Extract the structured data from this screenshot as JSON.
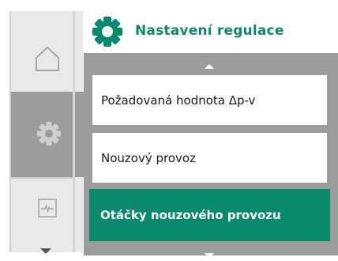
{
  "header": {
    "title": "Nastavení regulace",
    "icon": "gear-icon",
    "accent_color": "#0a8a6d"
  },
  "sidebar": {
    "items": [
      {
        "icon": "home-icon",
        "active": false
      },
      {
        "icon": "gear-icon",
        "active": true
      },
      {
        "icon": "pulse-icon",
        "active": false
      }
    ]
  },
  "menu": {
    "items": [
      {
        "label": "Požadovaná hodnota Δp-v",
        "selected": false
      },
      {
        "label": "Nouzový provoz",
        "selected": false
      },
      {
        "label": "Otáčky nouzového provozu",
        "selected": true
      }
    ],
    "selected_color": "#0a8a6d"
  }
}
